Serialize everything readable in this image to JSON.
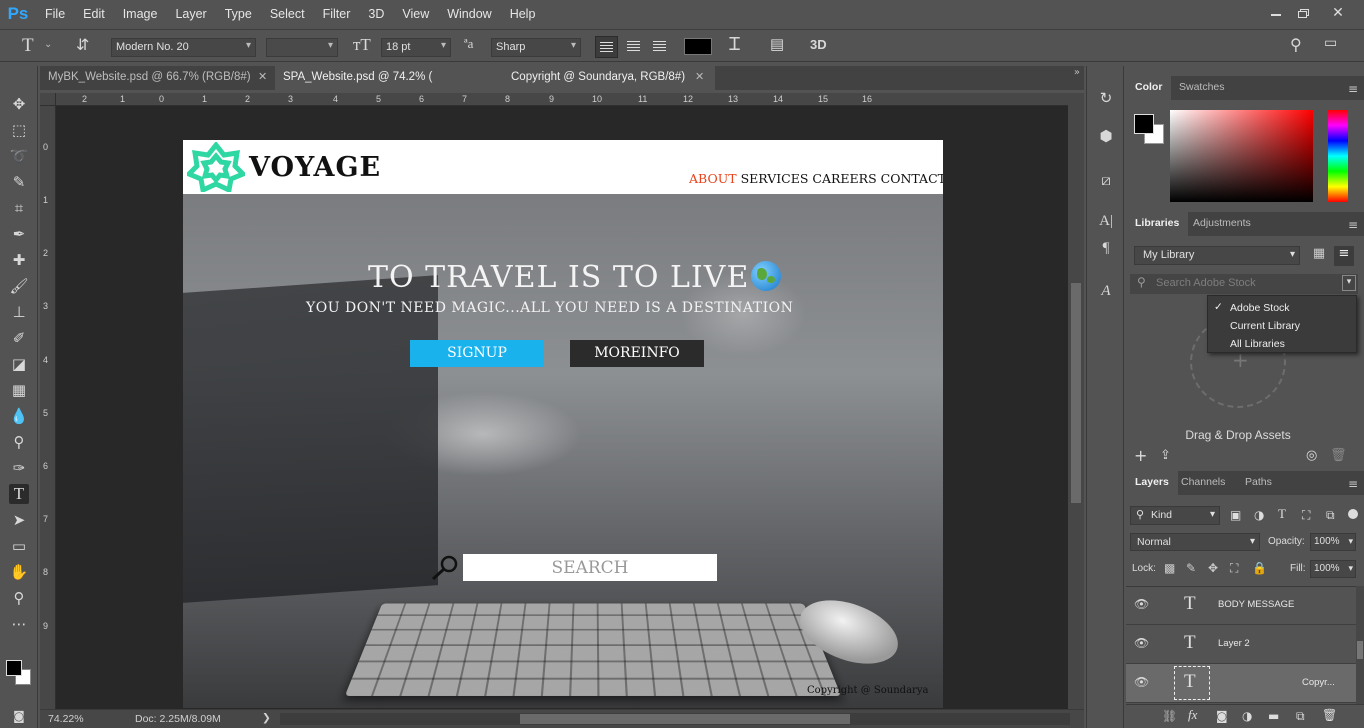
{
  "menubar": {
    "logo": "Ps",
    "items": [
      "File",
      "Edit",
      "Image",
      "Layer",
      "Type",
      "Select",
      "Filter",
      "3D",
      "View",
      "Window",
      "Help"
    ]
  },
  "options": {
    "font_family": "Modern No. 20",
    "font_size": "18 pt",
    "antialias": "Sharp",
    "threed": "3D",
    "text_color": "#000000"
  },
  "tabs": [
    {
      "label": "MyBK_Website.psd @ 66.7% (RGB/8#)"
    },
    {
      "label": "SPA_Website.psd @ 74.2% ("
    },
    {
      "label": "Copyright @ Soundarya, RGB/8#)"
    }
  ],
  "rulers": {
    "top": [
      "2",
      "1",
      "0",
      "1",
      "2",
      "3",
      "4",
      "5",
      "6",
      "7",
      "8",
      "9",
      "10",
      "11",
      "12",
      "13",
      "14",
      "15",
      "16"
    ],
    "left": [
      "0",
      "1",
      "2",
      "3",
      "4",
      "5",
      "6",
      "7",
      "8",
      "9"
    ]
  },
  "website": {
    "brand": "VOYAGE",
    "nav": [
      "ABOUT",
      "SERVICES",
      "CAREERS",
      "CONTACT"
    ],
    "nav_active_color": "#e8431b",
    "headline": "TO TRAVEL IS TO LIVE",
    "tagline": "YOU DON'T NEED MAGIC...ALL YOU NEED IS A DESTINATION",
    "signup": "SIGNUP",
    "moreinfo": "MOREINFO",
    "search_placeholder": "SEARCH",
    "copyright": "Copyright @ Soundarya",
    "accent_color": "#19b2ec",
    "logo_color": "#2fd7a2"
  },
  "color_panel": {
    "tabs": [
      "Color",
      "Swatches"
    ]
  },
  "libraries_panel": {
    "tabs": [
      "Libraries",
      "Adjustments"
    ],
    "library": "My Library",
    "search_placeholder": "Search Adobe Stock",
    "dropdown": [
      "Adobe Stock",
      "Current Library",
      "All Libraries"
    ],
    "checked": "Adobe Stock",
    "drag_text": "Drag & Drop Assets"
  },
  "layers_panel": {
    "tabs": [
      "Layers",
      "Channels",
      "Paths"
    ],
    "kind": "Kind",
    "blend_mode": "Normal",
    "opacity_label": "Opacity:",
    "opacity": "100%",
    "lock_label": "Lock:",
    "fill_label": "Fill:",
    "fill": "100%",
    "layers": [
      "BODY MESSAGE",
      "Layer 2",
      "Copyr..."
    ]
  },
  "status": {
    "zoom": "74.22%",
    "doc": "Doc: 2.25M/8.09M"
  }
}
